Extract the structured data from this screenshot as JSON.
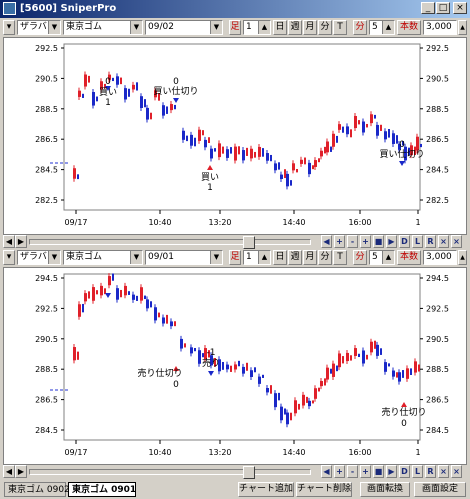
{
  "window": {
    "title": "[5600] SniperPro",
    "min": "_",
    "max": "□",
    "close": "×"
  },
  "colors": {
    "up": "#e0202a",
    "down": "#1a28c8",
    "ref": "#2030d0"
  },
  "charts": [
    {
      "toolbar": {
        "mode": "ザラバ",
        "symbol": "東京ゴム",
        "contract": "09/02",
        "daily_label": "足",
        "num": "1",
        "day": "日",
        "week": "週",
        "month": "月",
        "minute": "分",
        "tick": "T",
        "minute2": "分",
        "interval": "5",
        "count_label": "本数",
        "count": "3,000"
      },
      "y_ticks_left": [
        "292.5",
        "290.5",
        "288.5",
        "286.5",
        "284.5",
        "282.5"
      ],
      "y_ticks_right": [
        "292.5",
        "290.5",
        "288.5",
        "286.5",
        "284.5",
        "282.5"
      ],
      "x_ticks": [
        "09/17",
        "10:40",
        "13:20",
        "14:40",
        "16:00",
        "1"
      ],
      "annotations": [
        {
          "text": "0",
          "kind": "qty"
        },
        {
          "text": "買い",
          "kind": "signal"
        },
        {
          "text": "1",
          "kind": "qty"
        },
        {
          "text": "0",
          "kind": "qty"
        },
        {
          "text": "買い仕切り",
          "kind": "signal"
        },
        {
          "text": "買い",
          "kind": "signal"
        },
        {
          "text": "1",
          "kind": "qty"
        },
        {
          "text": "0",
          "kind": "qty"
        },
        {
          "text": "買い仕切り",
          "kind": "signal"
        }
      ]
    },
    {
      "toolbar": {
        "mode": "ザラバ",
        "symbol": "東京ゴム",
        "contract": "09/01",
        "daily_label": "足",
        "num": "1",
        "day": "日",
        "week": "週",
        "month": "月",
        "minute": "分",
        "tick": "T",
        "minute2": "分",
        "interval": "5",
        "count_label": "本数",
        "count": "3,000"
      },
      "y_ticks_left": [
        "294.5",
        "292.5",
        "290.5",
        "288.5",
        "286.5",
        "284.5"
      ],
      "y_ticks_right": [
        "294.5",
        "292.5",
        "290.5",
        "288.5",
        "286.5",
        "284.5"
      ],
      "x_ticks": [
        "09/17",
        "10:40",
        "13:20",
        "14:40",
        "16:00",
        "1"
      ],
      "annotations": [
        {
          "text": "-1",
          "kind": "qty"
        },
        {
          "text": "売り",
          "kind": "signal"
        },
        {
          "text": "売り仕切り",
          "kind": "signal"
        },
        {
          "text": "0",
          "kind": "qty"
        },
        {
          "text": "売り仕切り",
          "kind": "signal"
        },
        {
          "text": "0",
          "kind": "qty"
        }
      ]
    }
  ],
  "nav_buttons": [
    "◀",
    "+",
    "-",
    "+",
    "■",
    "▶",
    "D",
    "L",
    "R",
    "×",
    "×"
  ],
  "bottom": {
    "tabs": [
      "東京ゴム 0902",
      "東京ゴム 0901"
    ],
    "buttons": [
      "チャート追加",
      "チャート削除",
      "画面転換",
      "画面設定"
    ]
  }
}
